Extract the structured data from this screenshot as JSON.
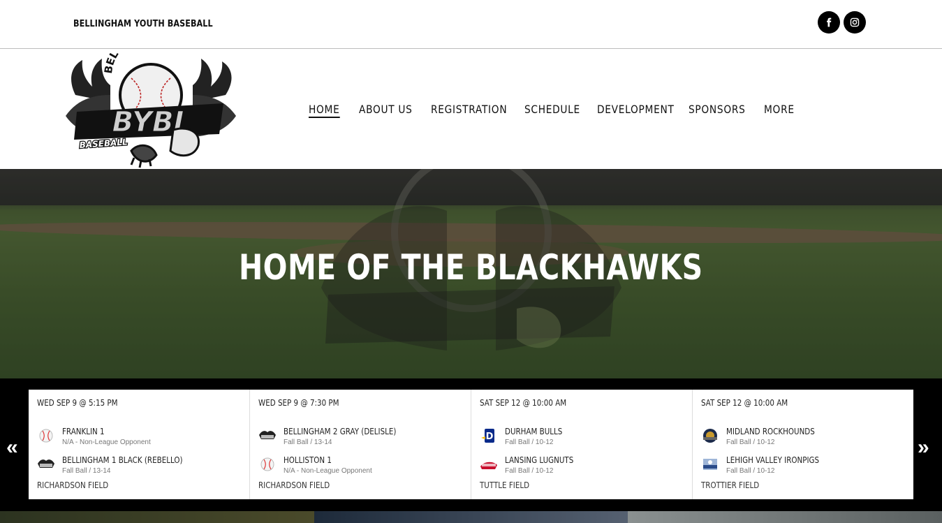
{
  "site": {
    "name": "BELLINGHAM YOUTH BASEBALL"
  },
  "social": {
    "facebook_icon": "facebook-icon",
    "instagram_icon": "instagram-icon"
  },
  "logo": {
    "top_text": "BELLINGHAM",
    "main_text": "BYBI",
    "bottom_text": "BASEBALL"
  },
  "nav": {
    "items": [
      {
        "label": "HOME",
        "active": true
      },
      {
        "label": "ABOUT US"
      },
      {
        "label": "REGISTRATION"
      },
      {
        "label": "SCHEDULE"
      },
      {
        "label": "DEVELOPMENT"
      },
      {
        "label": "SPONSORS"
      },
      {
        "label": "MORE"
      }
    ]
  },
  "hero": {
    "title": "HOME OF THE BLACKHAWKS"
  },
  "scores": {
    "prev_icon": "double-chevron-left-icon",
    "next_icon": "double-chevron-right-icon",
    "games": [
      {
        "date": "WED SEP 9 @ 5:15 PM",
        "home": {
          "name": "FRANKLIN 1",
          "sub": "N/A - Non-League Opponent",
          "logo": "baseball-icon"
        },
        "away": {
          "name": "BELLINGHAM 1 BLACK (REBELLO)",
          "sub": "Fall Ball / 13-14",
          "logo": "blackhawk-logo"
        },
        "field": "RICHARDSON FIELD"
      },
      {
        "date": "WED SEP 9 @ 7:30 PM",
        "home": {
          "name": "BELLINGHAM 2 GRAY (DELISLE)",
          "sub": "Fall Ball / 13-14",
          "logo": "blackhawk-logo"
        },
        "away": {
          "name": "HOLLISTON 1",
          "sub": "N/A - Non-League Opponent",
          "logo": "baseball-icon"
        },
        "field": "RICHARDSON FIELD"
      },
      {
        "date": "SAT SEP 12 @ 10:00 AM",
        "home": {
          "name": "DURHAM BULLS",
          "sub": "Fall Ball / 10-12",
          "logo": "durham-bulls-logo"
        },
        "away": {
          "name": "LANSING LUGNUTS",
          "sub": "Fall Ball / 10-12",
          "logo": "lugnuts-logo"
        },
        "field": "TUTTLE FIELD"
      },
      {
        "date": "SAT SEP 12 @ 10:00 AM",
        "home": {
          "name": "MIDLAND ROCKHOUNDS",
          "sub": "Fall Ball / 10-12",
          "logo": "rockhounds-logo"
        },
        "away": {
          "name": "LEHIGH VALLEY IRONPIGS",
          "sub": "Fall Ball / 10-12",
          "logo": "ironpigs-logo"
        },
        "field": "TROTTIER FIELD"
      }
    ]
  }
}
